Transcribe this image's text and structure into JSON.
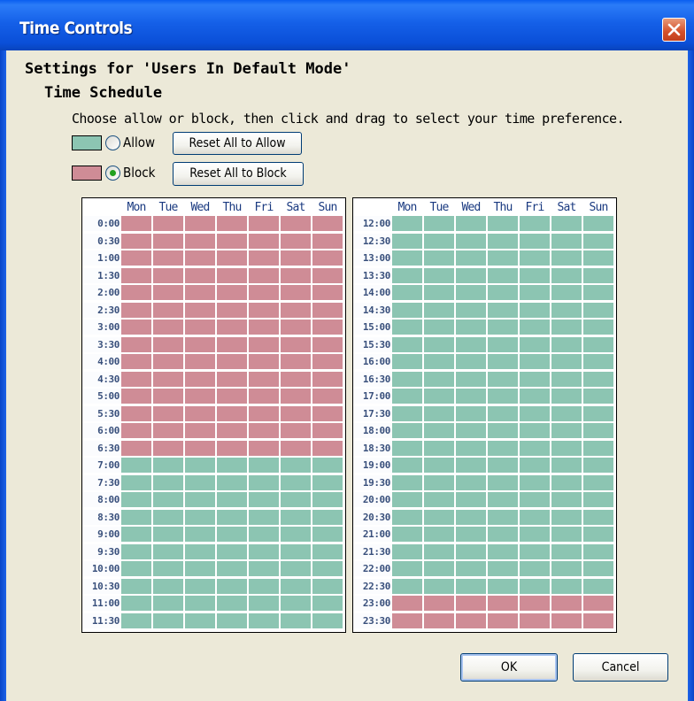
{
  "window": {
    "title": "Time Controls"
  },
  "settings_title": "Settings for 'Users In Default Mode'",
  "schedule_title": "Time Schedule",
  "instructions": "Choose allow or block, then click and drag to select your time preference.",
  "colors": {
    "allow": "#8cc5b2",
    "block": "#cf8c96",
    "title_bar": "#0a4fd8"
  },
  "legend": {
    "allow": {
      "label": "Allow",
      "selected": false,
      "reset_button": "Reset All to Allow"
    },
    "block": {
      "label": "Block",
      "selected": true,
      "reset_button": "Reset All to Block"
    }
  },
  "days": [
    "Mon",
    "Tue",
    "Wed",
    "Thu",
    "Fri",
    "Sat",
    "Sun"
  ],
  "am_grid": {
    "times": [
      "0:00",
      "0:30",
      "1:00",
      "1:30",
      "2:00",
      "2:30",
      "3:00",
      "3:30",
      "4:00",
      "4:30",
      "5:00",
      "5:30",
      "6:00",
      "6:30",
      "7:00",
      "7:30",
      "8:00",
      "8:30",
      "9:00",
      "9:30",
      "10:00",
      "10:30",
      "11:00",
      "11:30"
    ],
    "blocked_until": "7:00"
  },
  "pm_grid": {
    "times": [
      "12:00",
      "12:30",
      "13:00",
      "13:30",
      "14:00",
      "14:30",
      "15:00",
      "15:30",
      "16:00",
      "16:30",
      "17:00",
      "17:30",
      "18:00",
      "18:30",
      "19:00",
      "19:30",
      "20:00",
      "20:30",
      "21:00",
      "21:30",
      "22:00",
      "22:30",
      "23:00",
      "23:30"
    ],
    "blocked_from": "23:00"
  },
  "buttons": {
    "ok": "OK",
    "cancel": "Cancel"
  }
}
